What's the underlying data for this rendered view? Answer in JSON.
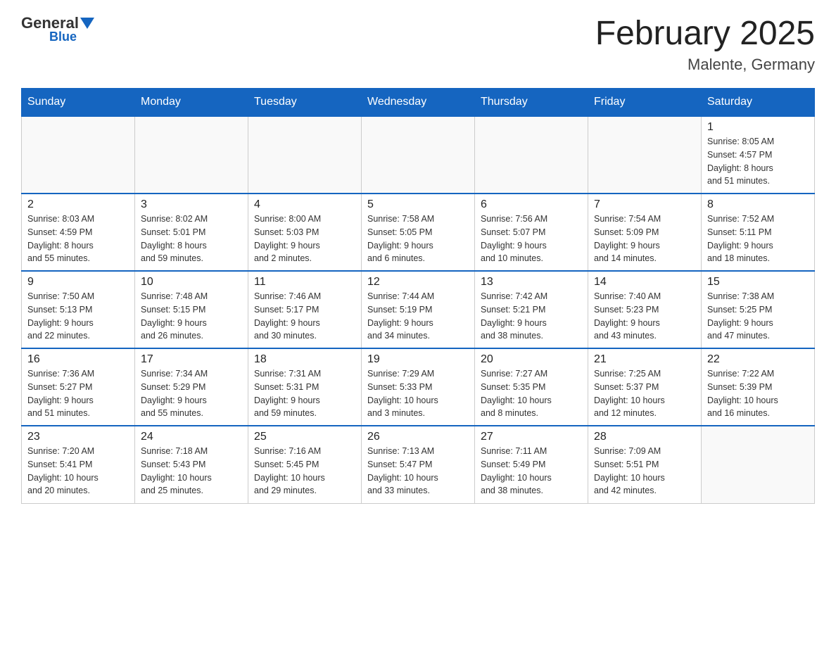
{
  "header": {
    "logo": {
      "text1": "General",
      "text2": "Blue"
    },
    "title": "February 2025",
    "location": "Malente, Germany"
  },
  "weekdays": [
    "Sunday",
    "Monday",
    "Tuesday",
    "Wednesday",
    "Thursday",
    "Friday",
    "Saturday"
  ],
  "weeks": [
    [
      {
        "day": "",
        "info": ""
      },
      {
        "day": "",
        "info": ""
      },
      {
        "day": "",
        "info": ""
      },
      {
        "day": "",
        "info": ""
      },
      {
        "day": "",
        "info": ""
      },
      {
        "day": "",
        "info": ""
      },
      {
        "day": "1",
        "info": "Sunrise: 8:05 AM\nSunset: 4:57 PM\nDaylight: 8 hours\nand 51 minutes."
      }
    ],
    [
      {
        "day": "2",
        "info": "Sunrise: 8:03 AM\nSunset: 4:59 PM\nDaylight: 8 hours\nand 55 minutes."
      },
      {
        "day": "3",
        "info": "Sunrise: 8:02 AM\nSunset: 5:01 PM\nDaylight: 8 hours\nand 59 minutes."
      },
      {
        "day": "4",
        "info": "Sunrise: 8:00 AM\nSunset: 5:03 PM\nDaylight: 9 hours\nand 2 minutes."
      },
      {
        "day": "5",
        "info": "Sunrise: 7:58 AM\nSunset: 5:05 PM\nDaylight: 9 hours\nand 6 minutes."
      },
      {
        "day": "6",
        "info": "Sunrise: 7:56 AM\nSunset: 5:07 PM\nDaylight: 9 hours\nand 10 minutes."
      },
      {
        "day": "7",
        "info": "Sunrise: 7:54 AM\nSunset: 5:09 PM\nDaylight: 9 hours\nand 14 minutes."
      },
      {
        "day": "8",
        "info": "Sunrise: 7:52 AM\nSunset: 5:11 PM\nDaylight: 9 hours\nand 18 minutes."
      }
    ],
    [
      {
        "day": "9",
        "info": "Sunrise: 7:50 AM\nSunset: 5:13 PM\nDaylight: 9 hours\nand 22 minutes."
      },
      {
        "day": "10",
        "info": "Sunrise: 7:48 AM\nSunset: 5:15 PM\nDaylight: 9 hours\nand 26 minutes."
      },
      {
        "day": "11",
        "info": "Sunrise: 7:46 AM\nSunset: 5:17 PM\nDaylight: 9 hours\nand 30 minutes."
      },
      {
        "day": "12",
        "info": "Sunrise: 7:44 AM\nSunset: 5:19 PM\nDaylight: 9 hours\nand 34 minutes."
      },
      {
        "day": "13",
        "info": "Sunrise: 7:42 AM\nSunset: 5:21 PM\nDaylight: 9 hours\nand 38 minutes."
      },
      {
        "day": "14",
        "info": "Sunrise: 7:40 AM\nSunset: 5:23 PM\nDaylight: 9 hours\nand 43 minutes."
      },
      {
        "day": "15",
        "info": "Sunrise: 7:38 AM\nSunset: 5:25 PM\nDaylight: 9 hours\nand 47 minutes."
      }
    ],
    [
      {
        "day": "16",
        "info": "Sunrise: 7:36 AM\nSunset: 5:27 PM\nDaylight: 9 hours\nand 51 minutes."
      },
      {
        "day": "17",
        "info": "Sunrise: 7:34 AM\nSunset: 5:29 PM\nDaylight: 9 hours\nand 55 minutes."
      },
      {
        "day": "18",
        "info": "Sunrise: 7:31 AM\nSunset: 5:31 PM\nDaylight: 9 hours\nand 59 minutes."
      },
      {
        "day": "19",
        "info": "Sunrise: 7:29 AM\nSunset: 5:33 PM\nDaylight: 10 hours\nand 3 minutes."
      },
      {
        "day": "20",
        "info": "Sunrise: 7:27 AM\nSunset: 5:35 PM\nDaylight: 10 hours\nand 8 minutes."
      },
      {
        "day": "21",
        "info": "Sunrise: 7:25 AM\nSunset: 5:37 PM\nDaylight: 10 hours\nand 12 minutes."
      },
      {
        "day": "22",
        "info": "Sunrise: 7:22 AM\nSunset: 5:39 PM\nDaylight: 10 hours\nand 16 minutes."
      }
    ],
    [
      {
        "day": "23",
        "info": "Sunrise: 7:20 AM\nSunset: 5:41 PM\nDaylight: 10 hours\nand 20 minutes."
      },
      {
        "day": "24",
        "info": "Sunrise: 7:18 AM\nSunset: 5:43 PM\nDaylight: 10 hours\nand 25 minutes."
      },
      {
        "day": "25",
        "info": "Sunrise: 7:16 AM\nSunset: 5:45 PM\nDaylight: 10 hours\nand 29 minutes."
      },
      {
        "day": "26",
        "info": "Sunrise: 7:13 AM\nSunset: 5:47 PM\nDaylight: 10 hours\nand 33 minutes."
      },
      {
        "day": "27",
        "info": "Sunrise: 7:11 AM\nSunset: 5:49 PM\nDaylight: 10 hours\nand 38 minutes."
      },
      {
        "day": "28",
        "info": "Sunrise: 7:09 AM\nSunset: 5:51 PM\nDaylight: 10 hours\nand 42 minutes."
      },
      {
        "day": "",
        "info": ""
      }
    ]
  ]
}
